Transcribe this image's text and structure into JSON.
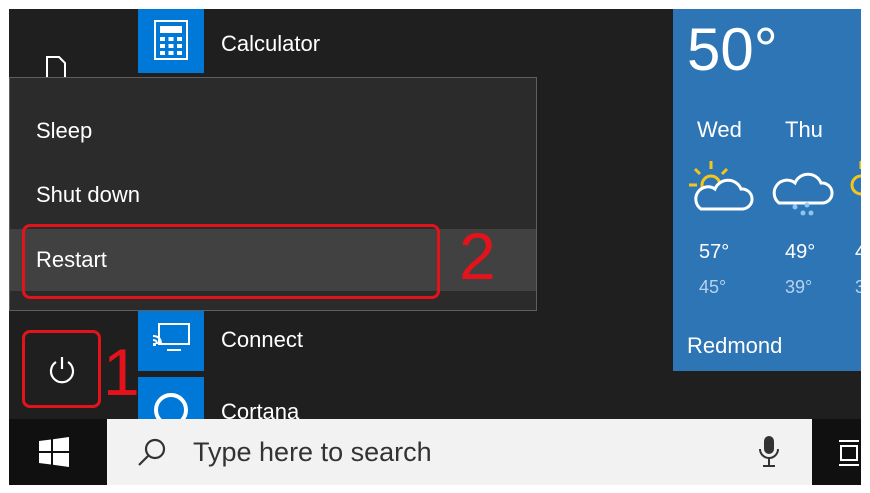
{
  "start_menu": {
    "apps": [
      {
        "label": "Calculator",
        "icon": "calculator-icon"
      },
      {
        "label": "Connect",
        "icon": "connect-icon"
      },
      {
        "label": "Cortana",
        "icon": "cortana-icon"
      }
    ]
  },
  "power_menu": {
    "items": [
      {
        "label": "Sleep"
      },
      {
        "label": "Shut down"
      },
      {
        "label": "Restart",
        "highlighted": true
      }
    ]
  },
  "annotations": {
    "step1": "1",
    "step2": "2",
    "color": "#e4131b"
  },
  "weather": {
    "current_temp": "50°",
    "days": [
      {
        "name": "Wed",
        "high": "57°",
        "low": "45°",
        "icon": "partly-sunny-icon"
      },
      {
        "name": "Thu",
        "high": "49°",
        "low": "39°",
        "icon": "rain-cloud-icon"
      },
      {
        "name": "",
        "high": "4",
        "low": "3",
        "icon": "partly-sunny-icon"
      }
    ],
    "location": "Redmond",
    "tile_color": "#2e75b6"
  },
  "taskbar": {
    "search_placeholder": "Type here to search",
    "accent": "#0078d7"
  }
}
